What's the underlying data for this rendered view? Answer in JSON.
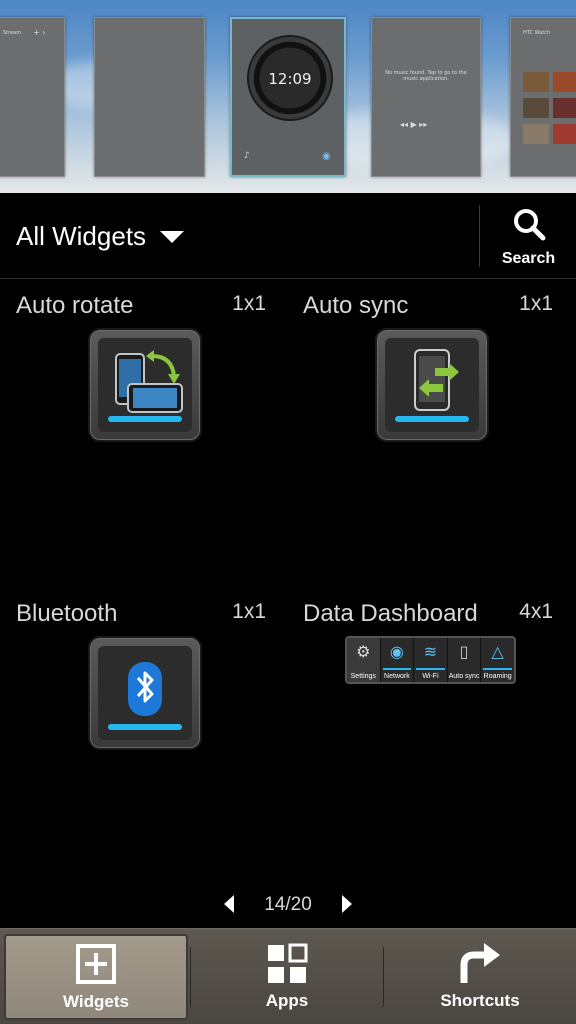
{
  "preview": {
    "panels": [
      {
        "label": "Stream"
      },
      {
        "label": ""
      },
      {
        "label": "12:09",
        "current": true
      },
      {
        "label": "No music found. Tap to go to the music application."
      },
      {
        "label": "HTC Watch"
      }
    ]
  },
  "header": {
    "category": "All Widgets",
    "search_label": "Search"
  },
  "widgets": [
    {
      "name": "Auto rotate",
      "size": "1x1",
      "icon": "auto-rotate-icon"
    },
    {
      "name": "Auto sync",
      "size": "1x1",
      "icon": "auto-sync-icon"
    },
    {
      "name": "Bluetooth",
      "size": "1x1",
      "icon": "bluetooth-icon"
    },
    {
      "name": "Data Dashboard",
      "size": "4x1",
      "icon": "data-dashboard-preview",
      "cells": [
        "Settings",
        "Network",
        "Wi-Fi",
        "Auto sync",
        "Roaming"
      ]
    }
  ],
  "pager": {
    "text": "14/20"
  },
  "tabs": [
    {
      "label": "Widgets",
      "active": true
    },
    {
      "label": "Apps",
      "active": false
    },
    {
      "label": "Shortcuts",
      "active": false
    }
  ],
  "colors": {
    "accent": "#28b6f0",
    "active_tab": "#a49a8c",
    "tabbar": "#4a4640"
  }
}
